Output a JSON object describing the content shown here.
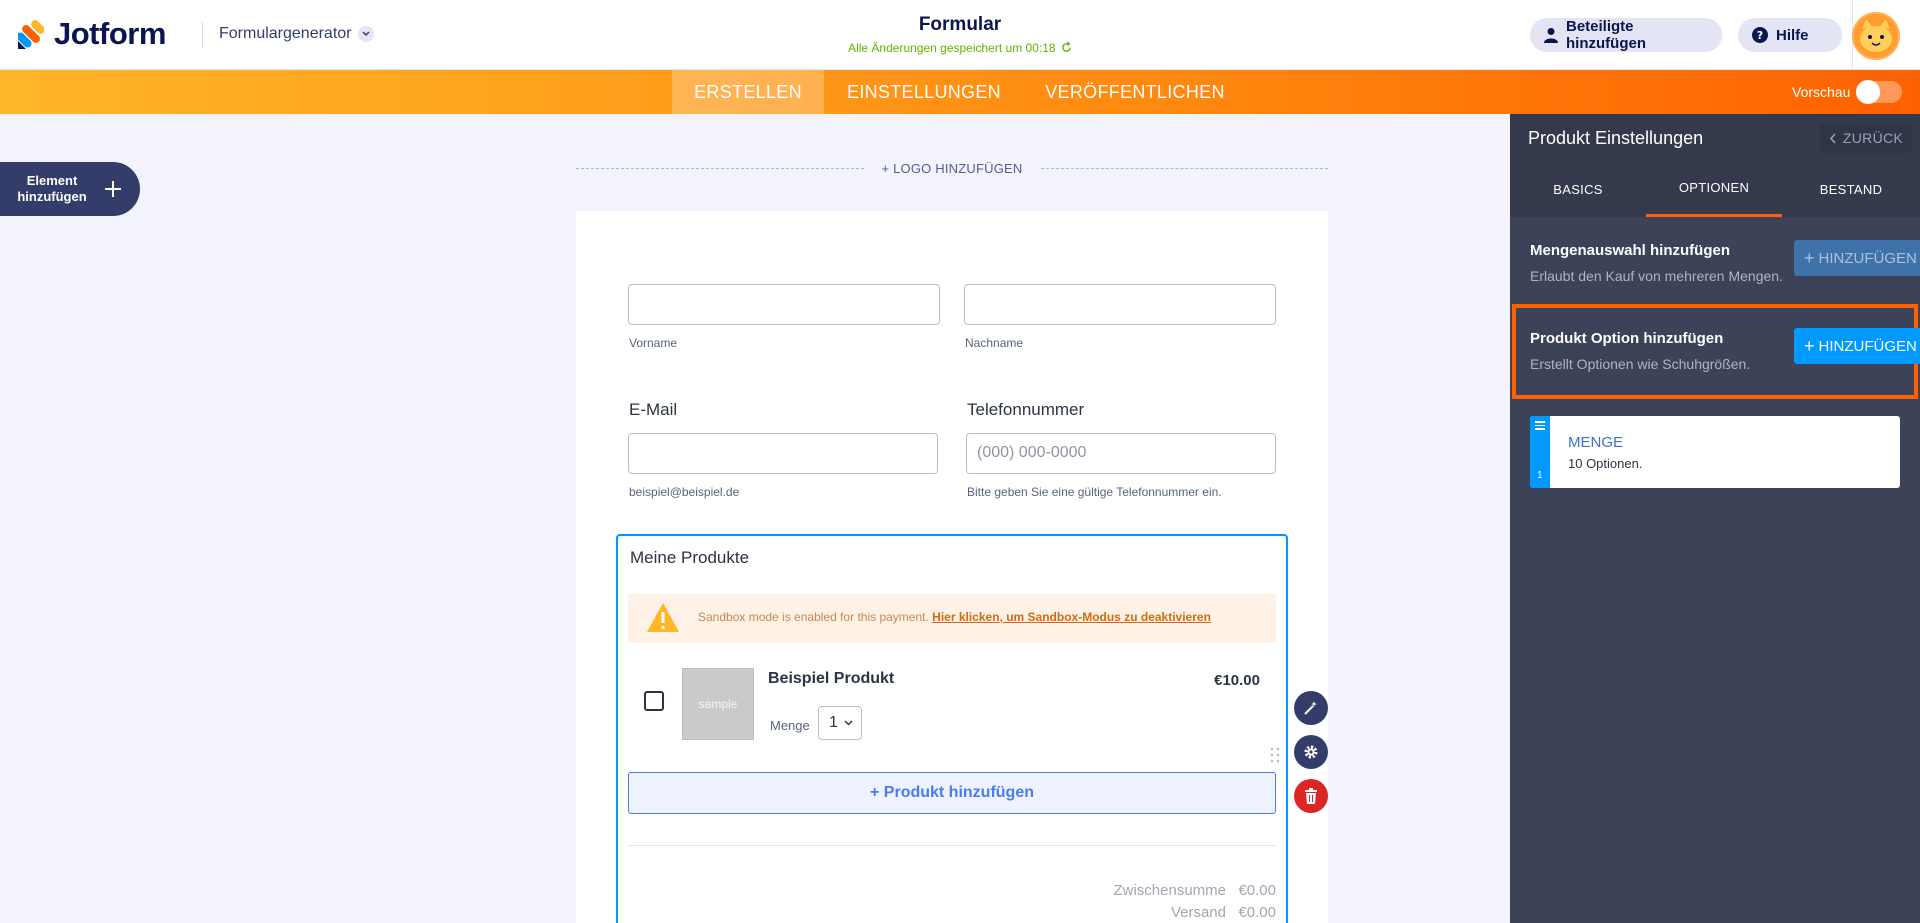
{
  "header": {
    "brand": "Jotform",
    "form_generator": "Formulargenerator",
    "form_title": "Formular",
    "saved_status": "Alle Änderungen gespeichert um 00:18",
    "invite_label": "Beteiligte hinzufügen",
    "help_label": "Hilfe"
  },
  "tabs": {
    "build": "ERSTELLEN",
    "settings": "EINSTELLUNGEN",
    "publish": "VERÖFFENTLICHEN",
    "preview": "Vorschau"
  },
  "sidebar": {
    "add_element_line1": "Element",
    "add_element_line2": "hinzufügen"
  },
  "form": {
    "logo_add": "+ LOGO HINZUFÜGEN",
    "first_name_sub": "Vorname",
    "last_name_sub": "Nachname",
    "email_label": "E-Mail",
    "email_sub": "beispiel@beispiel.de",
    "phone_label": "Telefonnummer",
    "phone_placeholder": "(000) 000-0000",
    "phone_sub": "Bitte geben Sie eine gültige Telefonnummer ein.",
    "products_title": "Meine Produkte",
    "sandbox_text": "Sandbox mode is enabled for this payment.",
    "sandbox_link": "Hier klicken, um Sandbox-Modus zu deaktivieren",
    "product": {
      "image_text": "sample",
      "name": "Beispiel Produkt",
      "price": "€10.00",
      "qty_label": "Menge",
      "qty_value": "1"
    },
    "add_product": "+ Produkt hinzufügen",
    "subtotal_label": "Zwischensumme",
    "subtotal_value": "€0.00",
    "shipping_label": "Versand",
    "shipping_value": "€0.00"
  },
  "panel": {
    "title": "Produkt Einstellungen",
    "back": "ZURÜCK",
    "tabs": [
      "BASICS",
      "OPTIONEN",
      "BESTAND"
    ],
    "qty_option_title": "Mengenauswahl hinzufügen",
    "qty_option_desc": "Erlaubt den Kauf von mehreren Mengen.",
    "product_option_title": "Produkt Option hinzufügen",
    "product_option_desc": "Erstellt Optionen wie Schuhgrößen.",
    "add_button": "HINZUFÜGEN",
    "menge_card": {
      "number": "1",
      "title": "MENGE",
      "subtitle": "10 Optionen."
    }
  },
  "colors": {
    "accent_orange": "#ff6100",
    "accent_blue": "#0099ff",
    "navy": "#0a1551",
    "panel_bg": "#3c4358"
  }
}
